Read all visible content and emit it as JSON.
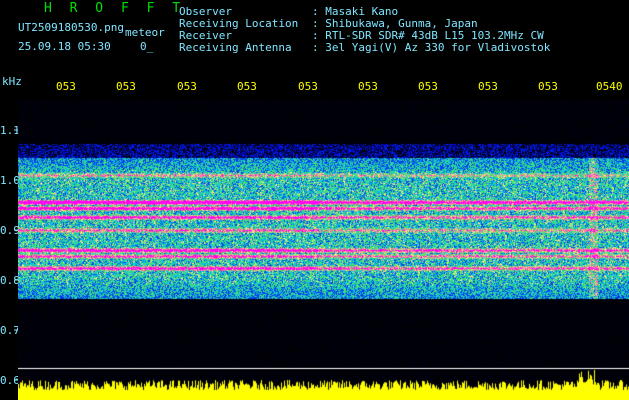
{
  "header": {
    "brand": "H R O F F T",
    "filename": "UT2509180530.png",
    "tag": "meteor",
    "datetime": "25.09.18 05:30",
    "small_mark": "0_"
  },
  "info": {
    "labels": [
      "Observer",
      "Receiving Location",
      "Receiver",
      "Receiving Antenna"
    ],
    "values": [
      ": Masaki Kano",
      ": Shibukawa, Gunma, Japan",
      ": RTL-SDR SDR# 43dB L15 103.2MHz CW",
      ": 3el Yagi(V) Az 330 for Vladivostok"
    ]
  },
  "axis": {
    "unit": "kHz",
    "y_ticks": [
      "1.1",
      "1.0",
      "0.9",
      "0.8",
      "0.7",
      "0.6"
    ],
    "time_ticks": [
      "053",
      "053",
      "053",
      "053",
      "053",
      "053",
      "053",
      "053",
      "053",
      "0540"
    ]
  },
  "colors": {
    "background": "#000000",
    "label_text": "#ffffff",
    "value_text": "#7fe6ff",
    "brand_text": "#00e000",
    "time_text": "#ffff00",
    "noise": "#ffff00"
  }
}
